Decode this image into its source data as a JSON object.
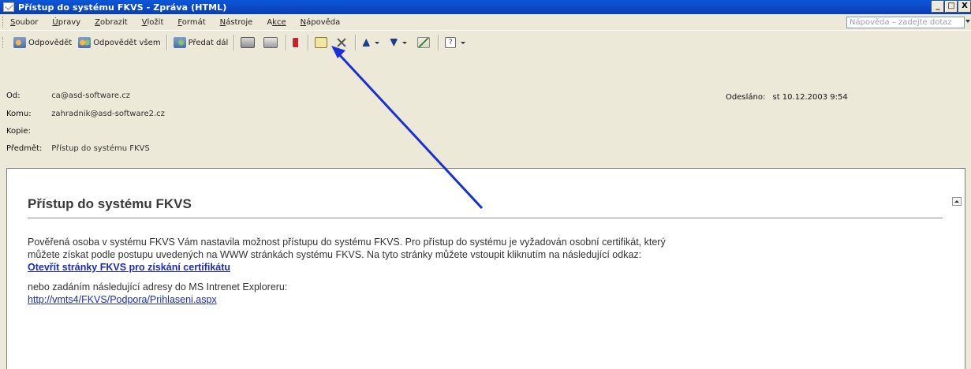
{
  "window": {
    "title": "Přístup do systému FKVS - Zpráva (HTML)",
    "buttons": [
      "_",
      "□",
      "X"
    ]
  },
  "menu": {
    "items": [
      {
        "accel": "S",
        "rest": "oubor"
      },
      {
        "accel": "Ú",
        "rest": "pravy"
      },
      {
        "accel": "Z",
        "rest": "obrazit"
      },
      {
        "accel": "V",
        "rest": "ložit"
      },
      {
        "accel": "F",
        "rest": "ormát"
      },
      {
        "accel": "N",
        "rest": "ástroje"
      },
      {
        "accel": "A",
        "rest": "kce"
      },
      {
        "accel": "N",
        "rest": "ápověda"
      }
    ],
    "help_placeholder": "Nápověda – zadejte dotaz"
  },
  "toolbar": {
    "reply": "Odpovědět",
    "reply_all": "Odpovědět všem",
    "forward": "Předat dál",
    "help_icon": "?"
  },
  "header": {
    "from_label": "Od:",
    "from_value": "ca@asd-software.cz",
    "to_label": "Komu:",
    "to_value": "zahradnik@asd-software2.cz",
    "cc_label": "Kopie:",
    "cc_value": "",
    "subject_label": "Předmět:",
    "subject_value": "Přístup do systému FKVS",
    "sent_label": "Odesláno:",
    "sent_value": "st 10.12.2003 9:54"
  },
  "message": {
    "title": "Přístup do systému FKVS",
    "para1_line1": "Pověřená osoba v systému FKVS Vám nastavila možnost přístupu do systému FKVS. Pro přístup do systému je vyžadován osobní certifikát, který",
    "para1_line2": "můžete získat podle postupu uvedených na WWW stránkách systému FKVS. Na tyto stránky můžete vstoupit kliknutím na následující odkaz:",
    "link1": "Otevřít stránky FKVS pro získání certifikátu",
    "para2": "nebo zadáním následující adresy do MS Intrenet Exploreru:",
    "link2": "http://vmts4/FKVS/Podpora/Prihlaseni.aspx"
  },
  "annotation": {
    "arrow_color": "#1a2fd6"
  }
}
